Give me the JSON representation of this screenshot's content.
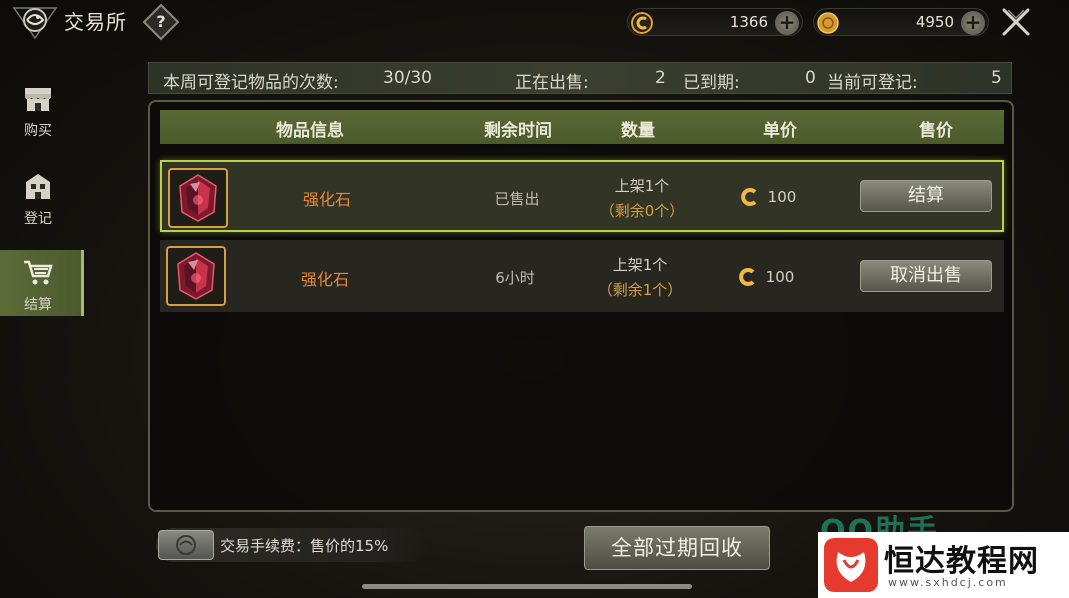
{
  "header": {
    "title": "交易所",
    "help_label": "?"
  },
  "currencies": [
    {
      "name": "coupon",
      "amount": "1366",
      "color": "#e6a23a"
    },
    {
      "name": "gold",
      "amount": "4950",
      "color": "#d69a2e"
    }
  ],
  "nav": {
    "items": [
      {
        "label": "购买",
        "icon": "shop-icon",
        "active": false
      },
      {
        "label": "登记",
        "icon": "building-icon",
        "active": false
      },
      {
        "label": "结算",
        "icon": "cart-icon",
        "active": true
      }
    ]
  },
  "stats": {
    "weekly_label": "本周可登记物品的次数:",
    "weekly_value": "30/30",
    "selling_label": "正在出售:",
    "selling_value": "2",
    "expired_label": "已到期:",
    "expired_value": "0",
    "available_label": "当前可登记:",
    "available_value": "5"
  },
  "table": {
    "columns": [
      "物品信息",
      "剩余时间",
      "数量",
      "单价",
      "售价"
    ],
    "rows": [
      {
        "item_name": "强化石",
        "time_left": "已售出",
        "qty_listed": "上架1个",
        "qty_remaining": "（剩余0个）",
        "unit_price": "100",
        "action": "结算",
        "selected": true
      },
      {
        "item_name": "强化石",
        "time_left": "6小时",
        "qty_listed": "上架1个",
        "qty_remaining": "（剩余1个）",
        "unit_price": "100",
        "action": "取消出售",
        "selected": false
      }
    ]
  },
  "footer": {
    "fee_text": "交易手续费：售价的15%",
    "recycle_button": "全部过期回收"
  },
  "watermark": {
    "ghost_text": "QQ助手",
    "title": "恒达教程网",
    "url": "www.sxhdcj.com"
  },
  "colors": {
    "accent_green": "#b8d34a",
    "header_olive": "#5a6a36",
    "item_orange": "#e8873a",
    "value_gold": "#d6a041",
    "value_green": "#9ccf4c",
    "value_red": "#e0553f"
  }
}
